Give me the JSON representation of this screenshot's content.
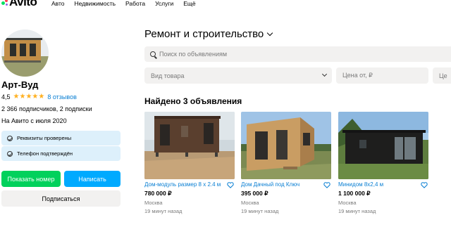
{
  "header": {
    "logo_text": "Avito",
    "nav": [
      "Авто",
      "Недвижимость",
      "Работа",
      "Услуги",
      "Ещё"
    ]
  },
  "profile": {
    "name": "Арт-Вуд",
    "rating": "4,5",
    "stars": 4.5,
    "reviews": "8 отзывов",
    "subscribers": "2 366 подписчиков, 2 подписки",
    "since": "На Авито с июля 2020",
    "verifications": [
      "Реквизиты проверены",
      "Телефон подтверждён"
    ],
    "buttons": {
      "show_phone": "Показать номер",
      "write": "Написать",
      "subscribe": "Подписаться"
    }
  },
  "main": {
    "category_title": "Ремонт и строительство",
    "search_placeholder": "Поиск по объявлениям",
    "filters": {
      "type_placeholder": "Вид товара",
      "price_from": "Цена от, ₽",
      "price_to": "Це"
    },
    "found_text": "Найдено 3 объявления",
    "listings": [
      {
        "title": "Дом-модуль размер 8 х 2.4 м",
        "price": "780 000 ₽",
        "city": "Москва",
        "time": "19 минут назад"
      },
      {
        "title": "Дом Дачный под Ключ",
        "price": "395 000 ₽",
        "city": "Москва",
        "time": "19 минут назад"
      },
      {
        "title": "Минидом 8х2,4 м",
        "price": "1 100 000 ₽",
        "city": "Москва",
        "time": "19 минут назад"
      }
    ]
  },
  "colors": {
    "brand_green": "#02d15c",
    "brand_blue": "#00aaff",
    "link_blue": "#0a7fd3",
    "star": "#ffb021",
    "verify_bg": "#ddf0fb"
  }
}
